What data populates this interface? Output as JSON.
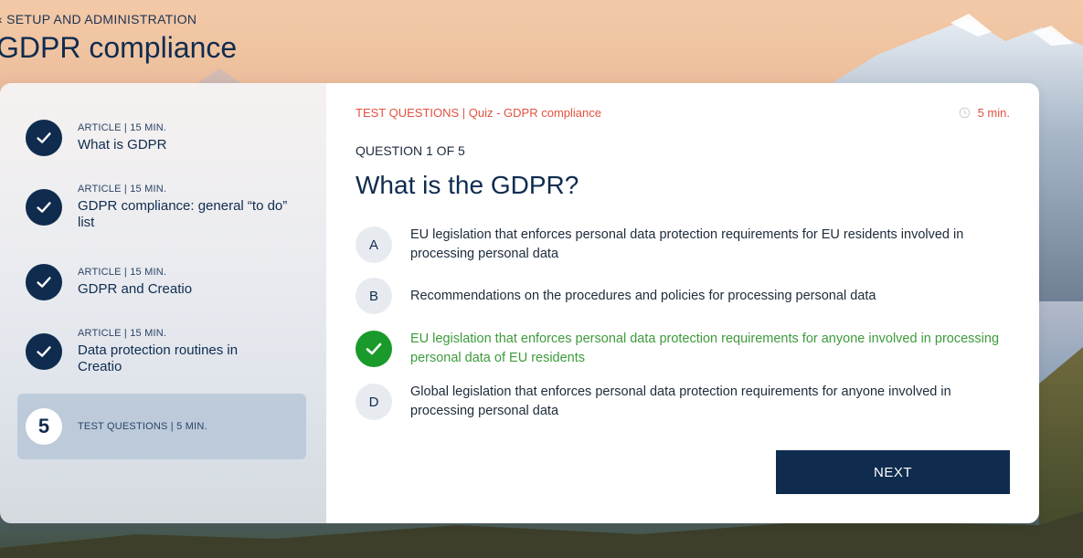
{
  "header": {
    "breadcrumb": "‹ SETUP AND ADMINISTRATION",
    "title": "GDPR compliance"
  },
  "sidebar": {
    "lessons": [
      {
        "meta": "ARTICLE | 15 MIN.",
        "name": "What is GDPR",
        "status": "completed"
      },
      {
        "meta": "ARTICLE | 15 MIN.",
        "name": "GDPR compliance: general “to do” list",
        "status": "completed"
      },
      {
        "meta": "ARTICLE | 15 MIN.",
        "name": "GDPR and Creatio",
        "status": "completed"
      },
      {
        "meta": "ARTICLE | 15 MIN.",
        "name": "Data protection routines in Creatio",
        "status": "completed"
      },
      {
        "meta": "TEST QUESTIONS | 5 MIN.",
        "number": "5",
        "status": "active"
      }
    ]
  },
  "quiz": {
    "label": "TEST QUESTIONS | Quiz - GDPR compliance",
    "duration": "5 min.",
    "counter": "QUESTION 1 OF 5",
    "question": "What is the GDPR?",
    "options": [
      {
        "letter": "A",
        "text": "EU legislation that enforces personal data protection requirements for EU residents involved in processing personal data",
        "selected": false
      },
      {
        "letter": "B",
        "text": "Recommendations on the procedures and policies for processing personal data",
        "selected": false
      },
      {
        "letter": "C",
        "text": "EU legislation that enforces personal data protection requirements for anyone involved in processing personal data of EU residents",
        "selected": true
      },
      {
        "letter": "D",
        "text": "Global legislation that enforces personal data protection requirements for anyone involved in processing personal data",
        "selected": false
      }
    ],
    "next_label": "NEXT"
  },
  "colors": {
    "primary": "#0f2c4f",
    "accent": "#e2513f",
    "correct": "#1a9a2a"
  }
}
